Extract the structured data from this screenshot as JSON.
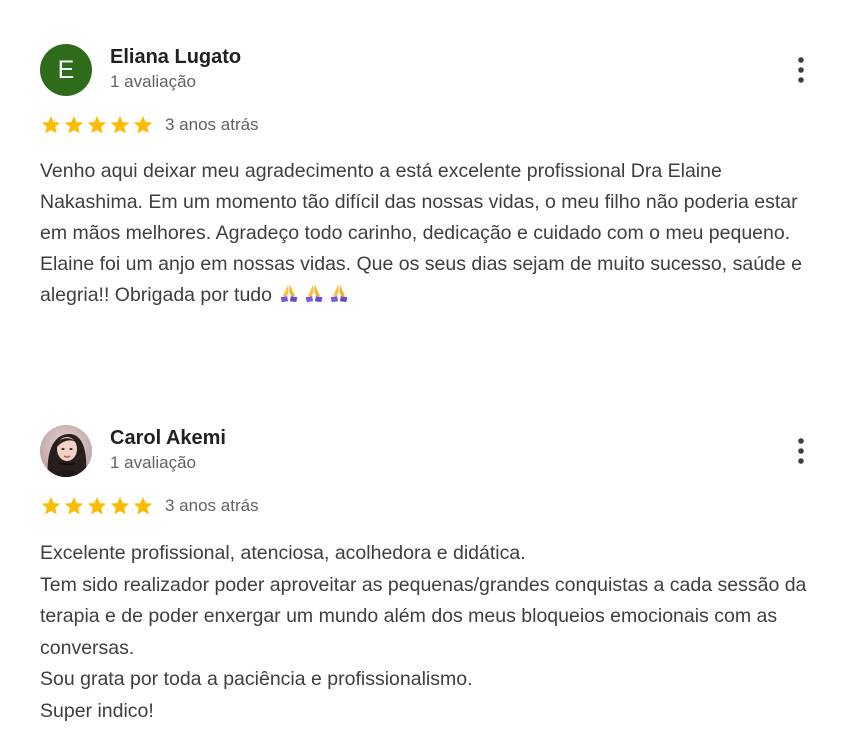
{
  "colors": {
    "star": "#fbbc04",
    "avatar_letter_bg": "#2e6b1a",
    "text": "#3c4043",
    "meta": "#5f6368",
    "name": "#202124"
  },
  "reviews": [
    {
      "avatar_letter": "E",
      "author": "Eliana Lugato",
      "review_count": "1 avaliação",
      "rating": 5,
      "date": "3 anos atrás",
      "text": "Venho aqui deixar meu agradecimento a está excelente profissional Dra Elaine Nakashima. Em um momento tão difícil das nossas vidas, o meu filho não poderia estar em mãos melhores. Agradeço todo carinho, dedicação e cuidado com o meu pequeno. Elaine foi um anjo em nossas vidas. Que os seus dias sejam de muito sucesso, saúde e alegria!! Obrigada por tudo",
      "emojis": [
        "folded-hands-icon",
        "folded-hands-icon",
        "folded-hands-icon"
      ],
      "more_icon": "more-vert-icon"
    },
    {
      "avatar_photo": "profile-photo",
      "author": "Carol Akemi",
      "review_count": "1 avaliação",
      "rating": 5,
      "date": "3 anos atrás",
      "text": "Excelente profissional, atenciosa, acolhedora e didática.\nTem sido realizador poder aproveitar as pequenas/grandes conquistas a cada sessão da terapia e de poder enxergar um mundo além dos meus bloqueios emocionais com as conversas.\nSou grata por toda a paciência e profissionalismo.\nSuper indico!",
      "more_icon": "more-vert-icon"
    }
  ]
}
